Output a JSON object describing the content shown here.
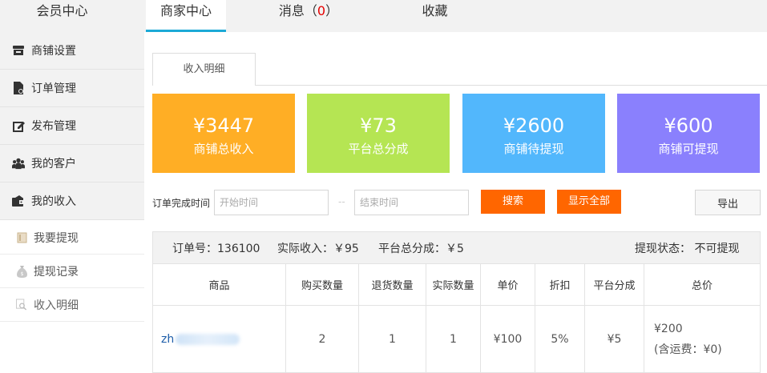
{
  "topnav": {
    "items": [
      {
        "label": "会员中心"
      },
      {
        "label": "商家中心"
      },
      {
        "label": "收藏"
      }
    ],
    "messages": {
      "label": "消息",
      "open": "（",
      "count": "0",
      "close": "）"
    }
  },
  "sidebar": {
    "items": [
      {
        "label": "商铺设置",
        "icon": "store-icon"
      },
      {
        "label": "订单管理",
        "icon": "order-document-icon"
      },
      {
        "label": "发布管理",
        "icon": "edit-icon"
      },
      {
        "label": "我的客户",
        "icon": "customers-icon"
      },
      {
        "label": "我的收入",
        "icon": "wallet-icon"
      }
    ],
    "subitems": [
      {
        "label": "我要提现",
        "icon": "card-icon"
      },
      {
        "label": "提现记录",
        "icon": "money-bag-icon"
      },
      {
        "label": "收入明细",
        "icon": "search-icon"
      }
    ]
  },
  "tab": {
    "label": "收入明细"
  },
  "stats": [
    {
      "amount": "¥3447",
      "label": "商铺总收入",
      "color": "#ffae25"
    },
    {
      "amount": "¥73",
      "label": "平台总分成",
      "color": "#b5e553"
    },
    {
      "amount": "¥2600",
      "label": "商铺待提现",
      "color": "#52b7fc"
    },
    {
      "amount": "¥600",
      "label": "商铺可提现",
      "color": "#8a80fd"
    }
  ],
  "filter": {
    "label": "订单完成时间",
    "start_placeholder": "开始时间",
    "separator": "--",
    "end_placeholder": "结束时间",
    "search_label": "搜索",
    "show_all_label": "显示全部",
    "export_label": "导出"
  },
  "order": {
    "number": "订单号：136100",
    "income": "实际收入：￥95",
    "platform_share": "平台总分成：￥5",
    "withdraw_status": "提现状态： 不可提现",
    "columns": [
      "商品",
      "购买数量",
      "退货数量",
      "实际数量",
      "单价",
      "折扣",
      "平台分成",
      "总价"
    ],
    "row": {
      "product": "zh",
      "quantity": "2",
      "returned": "1",
      "actual": "1",
      "unit_price": "¥100",
      "discount": "5%",
      "share": "¥5",
      "total": "¥200",
      "shipping": "(含运费：¥0)"
    }
  },
  "colors": {
    "accent": "#1ca9d6",
    "button_orange": "#ff6600",
    "badge_red": "#e60000"
  }
}
